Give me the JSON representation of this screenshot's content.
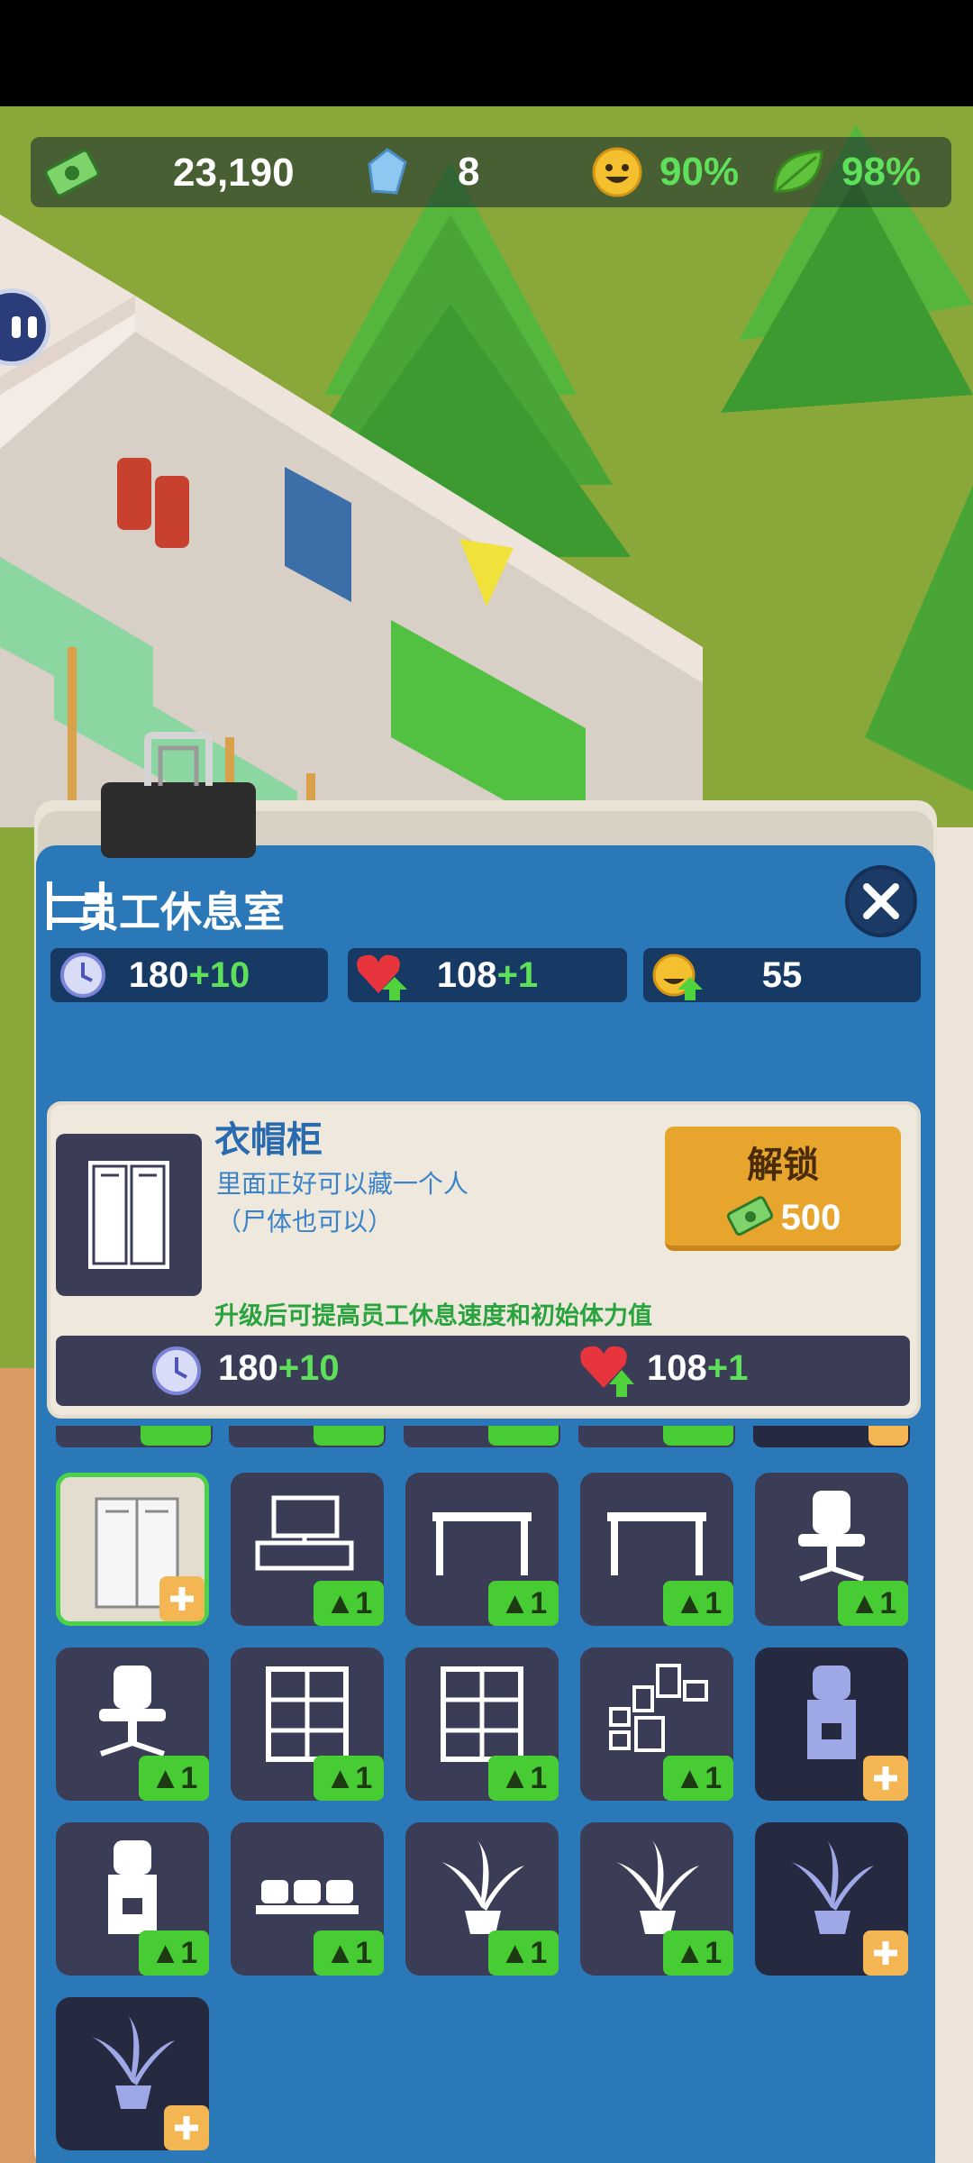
{
  "topbar": {
    "cash": "23,190",
    "gems": "8",
    "happiness": "90%",
    "eco": "98%",
    "icons": [
      "cash-icon",
      "diamond-icon",
      "smiley-icon",
      "leaf-icon"
    ]
  },
  "panel": {
    "title": "员工休息室",
    "stats": [
      {
        "base": "180",
        "bonus": "+10",
        "icon": "clock-icon"
      },
      {
        "base": "108",
        "bonus": "+1",
        "icon": "heart-up-icon"
      },
      {
        "base": "55",
        "bonus": "",
        "icon": "happy-up-icon"
      }
    ]
  },
  "detail": {
    "name": "衣帽柜",
    "desc_line1": "里面正好可以藏一个人",
    "desc_line2": "（尸体也可以）",
    "unlock_label": "解锁",
    "unlock_cost": "500",
    "upgrade_tip": "升级后可提高员工休息速度和初始体力值",
    "stat_time": "180",
    "stat_time_bonus": "+10",
    "stat_stamina": "108",
    "stat_stamina_bonus": "+1"
  },
  "grid": {
    "level_label": "1",
    "items": [
      "locker",
      "tv-cabinet",
      "desk",
      "desk",
      "office-chair",
      "office-chair",
      "shelf",
      "shelf",
      "wall-frames",
      "water-dispenser",
      "water-dispenser",
      "sofa",
      "plant",
      "plant",
      "plant",
      "plant"
    ]
  },
  "colors": {
    "panel": "#2b78b8",
    "accent_green": "#48cc34",
    "unlock": "#e8a52e"
  }
}
